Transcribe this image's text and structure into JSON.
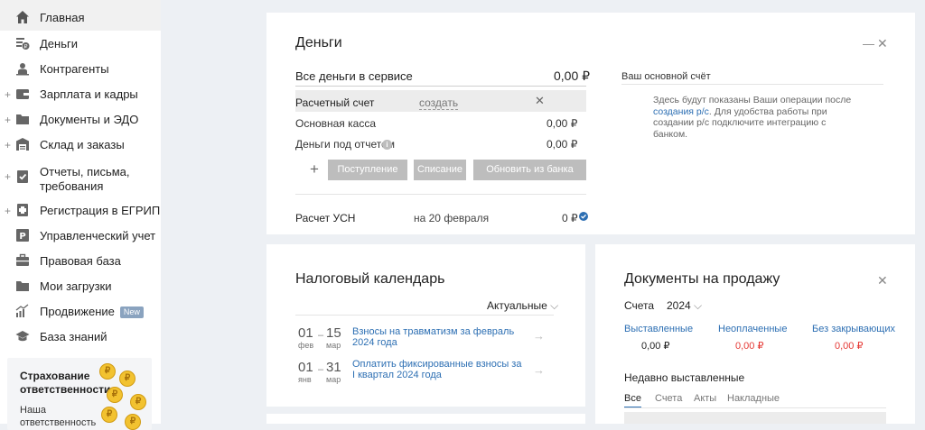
{
  "sidebar": {
    "items": [
      {
        "label": "Главная",
        "icon": "home-icon",
        "has_plus": false,
        "active": true
      },
      {
        "label": "Деньги",
        "icon": "money-icon",
        "has_plus": false
      },
      {
        "label": "Контрагенты",
        "icon": "contractors-icon",
        "has_plus": false
      },
      {
        "label": "Зарплата и кадры",
        "icon": "wallet-icon",
        "has_plus": true
      },
      {
        "label": "Документы и ЭДО",
        "icon": "folder-icon",
        "has_plus": true
      },
      {
        "label": "Склад и заказы",
        "icon": "warehouse-icon",
        "has_plus": true
      },
      {
        "label": "Отчеты, письма,",
        "label2": "требования",
        "icon": "report-check-icon",
        "has_plus": true
      },
      {
        "label": "Регистрация в ЕГРИП",
        "icon": "registration-icon",
        "has_plus": true
      },
      {
        "label": "Управленческий учет",
        "icon": "management-icon",
        "has_plus": false
      },
      {
        "label": "Правовая база",
        "icon": "briefcase-icon",
        "has_plus": false
      },
      {
        "label": "Мои загрузки",
        "icon": "downloads-folder-icon",
        "has_plus": false
      },
      {
        "label": "Продвижение",
        "icon": "promotion-chart-icon",
        "has_plus": false,
        "badge": "New"
      },
      {
        "label": "База знаний",
        "icon": "graduation-cap-icon",
        "has_plus": false
      }
    ],
    "promo": {
      "title": "Страхование ответственности",
      "text": "Наша ответственность застрахована на"
    }
  },
  "money": {
    "title": "Деньги",
    "total_label": "Все деньги в сервисе",
    "total_value": "0,00 ₽",
    "rows": [
      {
        "label": "Расчетный счет",
        "action": "создать"
      },
      {
        "label": "Основная касса",
        "value": "0,00 ₽"
      },
      {
        "label": "Деньги под отчетом",
        "value": "0,00 ₽"
      }
    ],
    "buttons": {
      "income": "Поступление",
      "expense": "Списание",
      "refresh": "Обновить из банка"
    },
    "usn": {
      "label": "Расчет УСН",
      "date": "на 20 февраля",
      "value": "0 ₽"
    },
    "main_account": {
      "title": "Ваш основной счёт",
      "text_before": "Здесь будут показаны Ваши операции после",
      "link": "создания р/с",
      "text_after": ". Для удобства работы при создании р/с подключите интеграцию с банком."
    }
  },
  "tax_calendar": {
    "title": "Налоговый календарь",
    "filter": "Актуальные",
    "events": [
      {
        "d1": "01",
        "m1": "фев",
        "d2": "15",
        "m2": "мар",
        "text": "Взносы на травматизм за февраль 2024 года"
      },
      {
        "d1": "01",
        "m1": "янв",
        "d2": "31",
        "m2": "мар",
        "text": "Оплатить фиксированные взносы за I квартал 2024 года"
      }
    ]
  },
  "sales_docs": {
    "title": "Документы на продажу",
    "type": "Счета",
    "year": "2024",
    "columns": [
      {
        "label": "Выставленные",
        "value": "0,00 ₽",
        "color": "#222222"
      },
      {
        "label": "Неоплаченные",
        "value": "0,00 ₽",
        "color": "#e53935"
      },
      {
        "label": "Без закрывающих",
        "value": "0,00 ₽",
        "color": "#e53935"
      }
    ],
    "recent_title": "Недавно выставленные",
    "tabs": [
      "Все",
      "Счета",
      "Акты",
      "Накладные"
    ]
  },
  "colors": {
    "accent": "#2d6fb3",
    "danger": "#e53935",
    "button_gray": "#bdbdbd"
  }
}
